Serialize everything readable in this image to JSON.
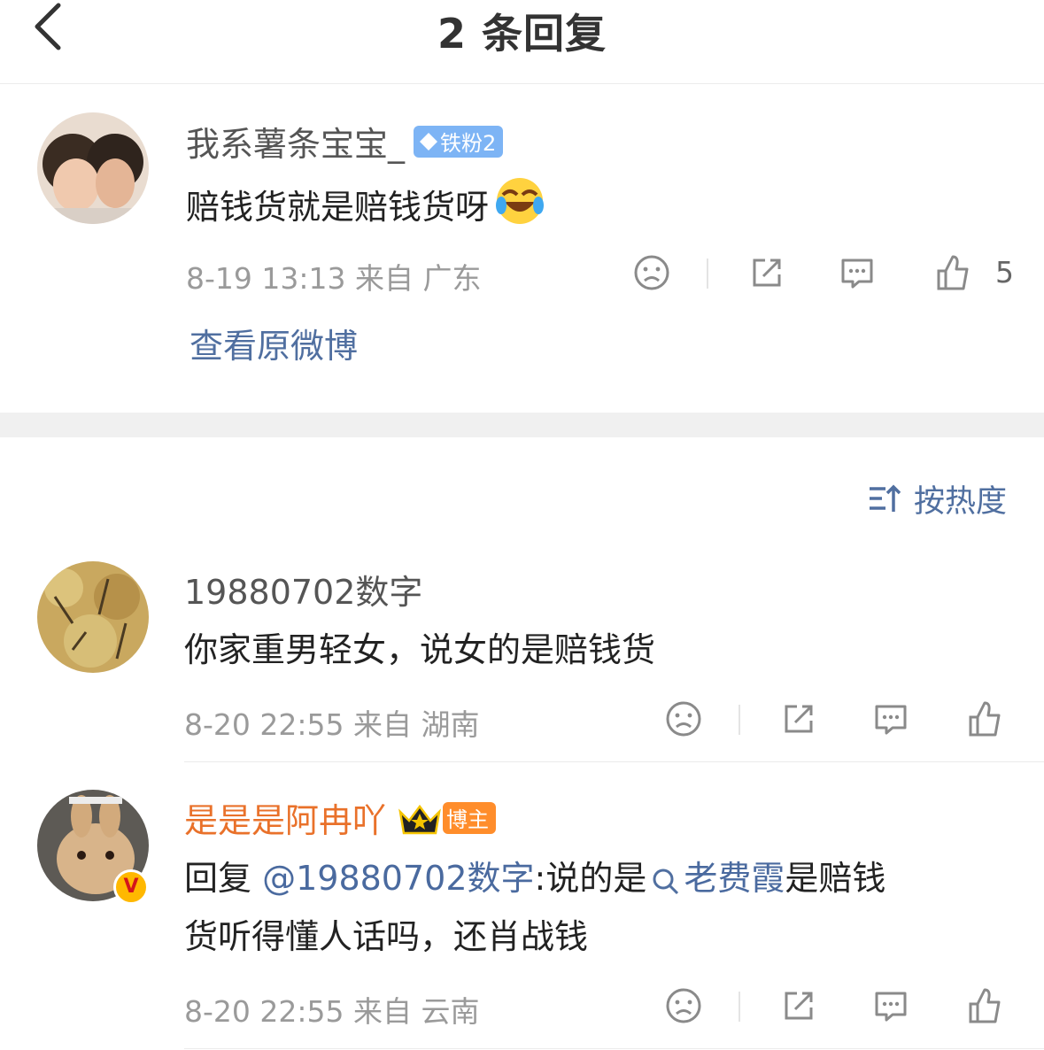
{
  "header": {
    "title": "2 条回复"
  },
  "main_comment": {
    "username": "我系薯条宝宝_",
    "badge": "铁粉2",
    "text": "赔钱货就是赔钱货呀",
    "emoji": "laugh-cry-emoji",
    "meta": "8-19 13:13  来自 广东",
    "like_count": "5",
    "view_original": "查看原微博"
  },
  "sort": {
    "label": "按热度"
  },
  "replies": [
    {
      "username": "19880702数字",
      "text": "你家重男轻女，说女的是赔钱货",
      "meta": "8-20 22:55  来自 湖南"
    },
    {
      "username": "是是是阿冉吖",
      "badge": "博主",
      "text_prefix": "回复 ",
      "mention": "@19880702数字",
      "text_mid": ":说的是",
      "topic": "老费霞",
      "text_suffix": "是赔钱",
      "text_line2": "货听得懂人话吗，还肖战钱",
      "meta": "8-20 22:55  来自 云南",
      "verified": "V"
    }
  ],
  "colors": {
    "link": "#506fa0",
    "host_name": "#e9712a",
    "fan_badge": "#7db4f5",
    "host_badge": "#ff8d2b"
  }
}
